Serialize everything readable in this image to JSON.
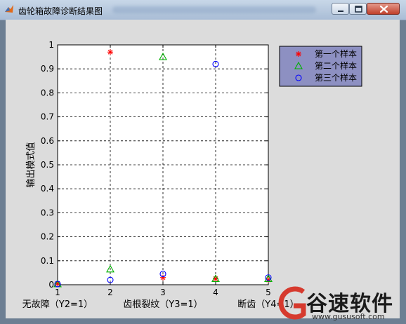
{
  "window": {
    "title": "齿轮箱故障诊断结果图"
  },
  "chart_data": {
    "type": "scatter",
    "title": "",
    "xlabel": "",
    "ylabel": "输出模式值",
    "xlim": [
      1,
      5
    ],
    "ylim": [
      0,
      1
    ],
    "x_ticks": [
      1,
      2,
      3,
      4,
      5
    ],
    "y_ticks": [
      0,
      0.1,
      0.2,
      0.3,
      0.4,
      0.5,
      0.6,
      0.7,
      0.8,
      0.9,
      1
    ],
    "y_tick_labels": [
      "0",
      "0.1",
      "0.2",
      "0.3",
      "0.4",
      "0.5",
      "0.6",
      "0.7",
      "0.8",
      "0.9",
      "1"
    ],
    "grid": true,
    "legend_position": "outside-top-right",
    "category_labels": [
      {
        "x": 1,
        "text": "无故障（Y2=1）"
      },
      {
        "x": 3,
        "text": "齿根裂纹（Y3=1）"
      },
      {
        "x": 5,
        "text": "断齿（Y4=1）"
      }
    ],
    "series": [
      {
        "name": "第一个样本",
        "marker": "star",
        "color": "#ff0000",
        "x": [
          1,
          2,
          3,
          4,
          5
        ],
        "y": [
          0.005,
          0.97,
          0.03,
          0.025,
          0.02
        ]
      },
      {
        "name": "第二个样本",
        "marker": "triangle",
        "color": "#00b000",
        "x": [
          1,
          2,
          3,
          4,
          5
        ],
        "y": [
          0.003,
          0.065,
          0.95,
          0.025,
          0.025
        ]
      },
      {
        "name": "第三个样本",
        "marker": "circle",
        "color": "#0000ff",
        "x": [
          1,
          2,
          3,
          4,
          5
        ],
        "y": [
          0.003,
          0.02,
          0.045,
          0.92,
          0.03
        ]
      }
    ]
  },
  "watermark": {
    "brand": "谷速软件",
    "url": "www.gususoft.com"
  }
}
